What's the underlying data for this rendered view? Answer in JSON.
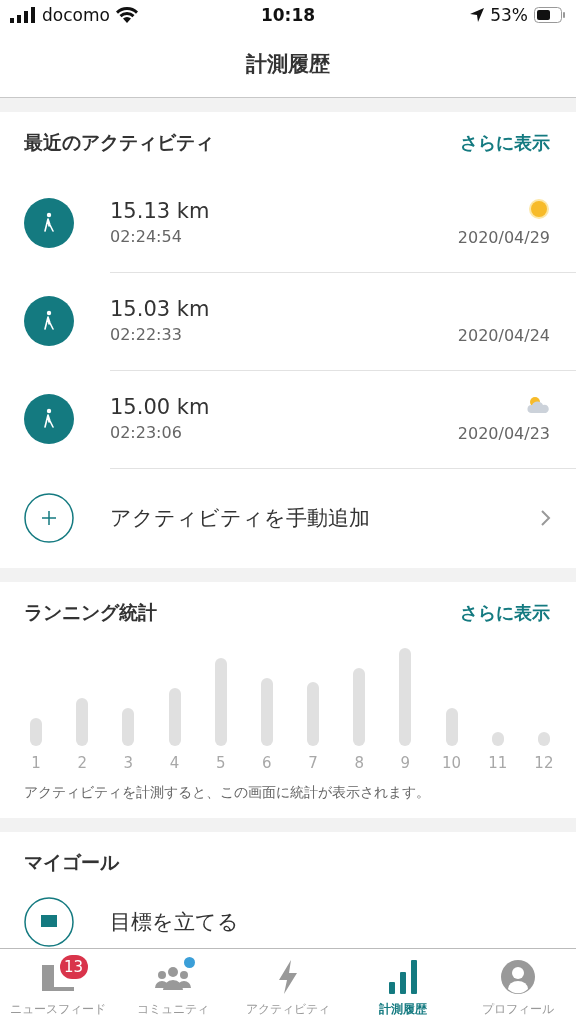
{
  "status_bar": {
    "carrier": "docomo",
    "time": "10:18",
    "battery": "53%"
  },
  "header": {
    "title": "計測履歴"
  },
  "recent": {
    "title": "最近のアクティビティ",
    "more": "さらに表示",
    "activities": [
      {
        "distance": "15.13 km",
        "duration": "02:24:54",
        "date": "2020/04/29",
        "weather": {
          "kind": "sunny"
        }
      },
      {
        "distance": "15.03 km",
        "duration": "02:22:33",
        "date": "2020/04/24"
      },
      {
        "distance": "15.00 km",
        "duration": "02:23:06",
        "date": "2020/04/23",
        "weather": {
          "kind": "partly_cloudy"
        }
      }
    ],
    "add_label": "アクティビティを手動追加"
  },
  "stats": {
    "title": "ランニング統計",
    "more": "さらに表示",
    "labels": [
      "1",
      "2",
      "3",
      "4",
      "5",
      "6",
      "7",
      "8",
      "9",
      "10",
      "11",
      "12"
    ],
    "note": "アクティビティを計測すると、この画面に統計が表示されます。"
  },
  "goals": {
    "title": "マイゴール",
    "item": "目標を立てる"
  },
  "tabs": [
    {
      "kind": "news",
      "label": "ニュースフィード",
      "selected": false,
      "badge": "13"
    },
    {
      "kind": "community",
      "label": "コミュニティ",
      "selected": false,
      "dot": true
    },
    {
      "kind": "activity",
      "label": "アクティビティ",
      "selected": false
    },
    {
      "kind": "history",
      "label": "計測履歴",
      "selected": true
    },
    {
      "kind": "profile",
      "label": "プロフィール",
      "selected": false
    }
  ]
}
